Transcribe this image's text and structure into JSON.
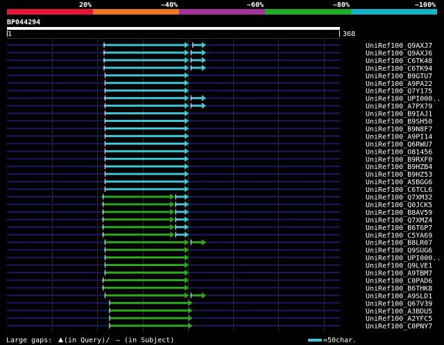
{
  "chart_data": {
    "type": "alignment-overview",
    "identity_legend": [
      {
        "label": "20%",
        "color": "#e8153a"
      },
      {
        "label": "~40%",
        "color": "#ee7722"
      },
      {
        "label": "~60%",
        "color": "#a33399"
      },
      {
        "label": "~80%",
        "color": "#22aa22"
      },
      {
        "label": "~100%",
        "color": "#14b4c4"
      }
    ],
    "query": {
      "name": "BP044294",
      "start_label": "1",
      "end_label": "368",
      "length": 368
    },
    "palette": {
      "hit_cyan": "#3ec8d8",
      "hit_green": "#2aaa1a",
      "backbone": "#1a1a66",
      "grid": "#2a2a2a",
      "gap": "#aaaaaa"
    },
    "hits": [
      {
        "id": "UniRef100_Q9AXJ7",
        "color": "cyan",
        "segs": [
          [
            107,
            201,
            0
          ],
          [
            205,
            220,
            0
          ]
        ],
        "gap_mark": 107
      },
      {
        "id": "UniRef100_Q9AXJ6",
        "color": "cyan",
        "segs": [
          [
            107,
            201,
            0
          ],
          [
            203,
            220,
            0
          ]
        ],
        "gap_mark": 107
      },
      {
        "id": "UniRef100_C6TK48",
        "color": "cyan",
        "segs": [
          [
            107,
            201,
            0
          ],
          [
            203,
            220,
            0
          ]
        ],
        "gap_mark": 107
      },
      {
        "id": "UniRef100_C6TK94",
        "color": "cyan",
        "segs": [
          [
            107,
            201,
            0
          ],
          [
            203,
            220,
            0
          ]
        ],
        "gap_mark": 107
      },
      {
        "id": "UniRef100_B9GTU7",
        "color": "cyan",
        "segs": [
          [
            108,
            201,
            0
          ]
        ]
      },
      {
        "id": "UniRef100_A9PA22",
        "color": "cyan",
        "segs": [
          [
            108,
            201,
            0
          ]
        ]
      },
      {
        "id": "UniRef100_Q7Y175",
        "color": "cyan",
        "segs": [
          [
            108,
            201,
            0
          ]
        ]
      },
      {
        "id": "UniRef100_UPI000..",
        "color": "cyan",
        "segs": [
          [
            108,
            201,
            0
          ],
          [
            203,
            220,
            0
          ]
        ],
        "gap_mark": 108
      },
      {
        "id": "UniRef100_A7PX79",
        "color": "cyan",
        "segs": [
          [
            108,
            201,
            0
          ],
          [
            203,
            220,
            0
          ]
        ],
        "gap_mark": 108
      },
      {
        "id": "UniRef100_B9IAJ1",
        "color": "cyan",
        "segs": [
          [
            108,
            201,
            0
          ]
        ]
      },
      {
        "id": "UniRef100_B9SH50",
        "color": "cyan",
        "segs": [
          [
            108,
            201,
            0
          ]
        ]
      },
      {
        "id": "UniRef100_B9N8F7",
        "color": "cyan",
        "segs": [
          [
            108,
            201,
            0
          ]
        ]
      },
      {
        "id": "UniRef100_A9PI14",
        "color": "cyan",
        "segs": [
          [
            108,
            201,
            0
          ]
        ]
      },
      {
        "id": "UniRef100_Q6RWU7",
        "color": "cyan",
        "segs": [
          [
            108,
            201,
            0
          ]
        ]
      },
      {
        "id": "UniRef100_O81456",
        "color": "cyan",
        "segs": [
          [
            108,
            201,
            0
          ]
        ]
      },
      {
        "id": "UniRef100_B9RXF0",
        "color": "cyan",
        "segs": [
          [
            108,
            201,
            0
          ]
        ]
      },
      {
        "id": "UniRef100_B9HZB4",
        "color": "cyan",
        "segs": [
          [
            108,
            201,
            0
          ]
        ]
      },
      {
        "id": "UniRef100_B9HZ53",
        "color": "cyan",
        "segs": [
          [
            108,
            201,
            0
          ]
        ]
      },
      {
        "id": "UniRef100_A5BGG6",
        "color": "cyan",
        "segs": [
          [
            108,
            201,
            0
          ]
        ]
      },
      {
        "id": "UniRef100_C6TCL6",
        "color": "cyan",
        "segs": [
          [
            108,
            201,
            0
          ]
        ]
      },
      {
        "id": "UniRef100_Q7XM32",
        "color": "green",
        "segs": [
          [
            106,
            185,
            0
          ],
          [
            186,
            201,
            1
          ]
        ],
        "gap_mark": 106
      },
      {
        "id": "UniRef100_Q0JCK5",
        "color": "green",
        "segs": [
          [
            106,
            185,
            0
          ],
          [
            186,
            201,
            1
          ]
        ],
        "gap_mark": 106
      },
      {
        "id": "UniRef100_B8AV59",
        "color": "green",
        "segs": [
          [
            106,
            185,
            0
          ],
          [
            186,
            201,
            1
          ]
        ],
        "gap_mark": 106
      },
      {
        "id": "UniRef100_Q7XMZ4",
        "color": "green",
        "segs": [
          [
            106,
            185,
            0
          ],
          [
            186,
            201,
            1
          ]
        ],
        "gap_mark": 106
      },
      {
        "id": "UniRef100_B6T6P7",
        "color": "green",
        "segs": [
          [
            106,
            185,
            0
          ],
          [
            186,
            201,
            1
          ]
        ],
        "gap_mark": 106
      },
      {
        "id": "UniRef100_C5YA69",
        "color": "green",
        "segs": [
          [
            106,
            185,
            0
          ],
          [
            186,
            201,
            1
          ]
        ],
        "gap_mark": 106
      },
      {
        "id": "UniRef100_B8LR07",
        "color": "green",
        "segs": [
          [
            108,
            201,
            0
          ],
          [
            203,
            220,
            0
          ]
        ]
      },
      {
        "id": "UniRef100_Q9SUG6",
        "color": "green",
        "segs": [
          [
            108,
            201,
            0
          ]
        ]
      },
      {
        "id": "UniRef100_UPI000..",
        "color": "green",
        "segs": [
          [
            108,
            201,
            0
          ]
        ]
      },
      {
        "id": "UniRef100_Q9LVE1",
        "color": "green",
        "segs": [
          [
            108,
            201,
            0
          ]
        ]
      },
      {
        "id": "UniRef100_A9TBM7",
        "color": "green",
        "segs": [
          [
            108,
            201,
            0
          ]
        ]
      },
      {
        "id": "UniRef100_C0PAD6",
        "color": "green",
        "segs": [
          [
            106,
            201,
            0
          ]
        ],
        "gap_mark": 106
      },
      {
        "id": "UniRef100_B6THK8",
        "color": "green",
        "segs": [
          [
            106,
            201,
            0
          ]
        ],
        "gap_mark": 106
      },
      {
        "id": "UniRef100_A9SLD1",
        "color": "green",
        "segs": [
          [
            108,
            201,
            0
          ],
          [
            203,
            220,
            0
          ]
        ]
      },
      {
        "id": "UniRef100_Q67V39",
        "color": "green",
        "segs": [
          [
            113,
            205,
            0
          ]
        ]
      },
      {
        "id": "UniRef100_A3BDU5",
        "color": "green",
        "segs": [
          [
            113,
            205,
            0
          ]
        ]
      },
      {
        "id": "UniRef100_A2YFC5",
        "color": "green",
        "segs": [
          [
            113,
            205,
            0
          ]
        ]
      },
      {
        "id": "UniRef100_C0PNY7",
        "color": "green",
        "segs": [
          [
            113,
            205,
            0
          ]
        ]
      }
    ]
  },
  "footer": {
    "large_gaps_prefix": "Large gaps:",
    "in_query": "(in Query)/",
    "in_subject": "– (in Subject)",
    "scale_label": "=50char."
  }
}
